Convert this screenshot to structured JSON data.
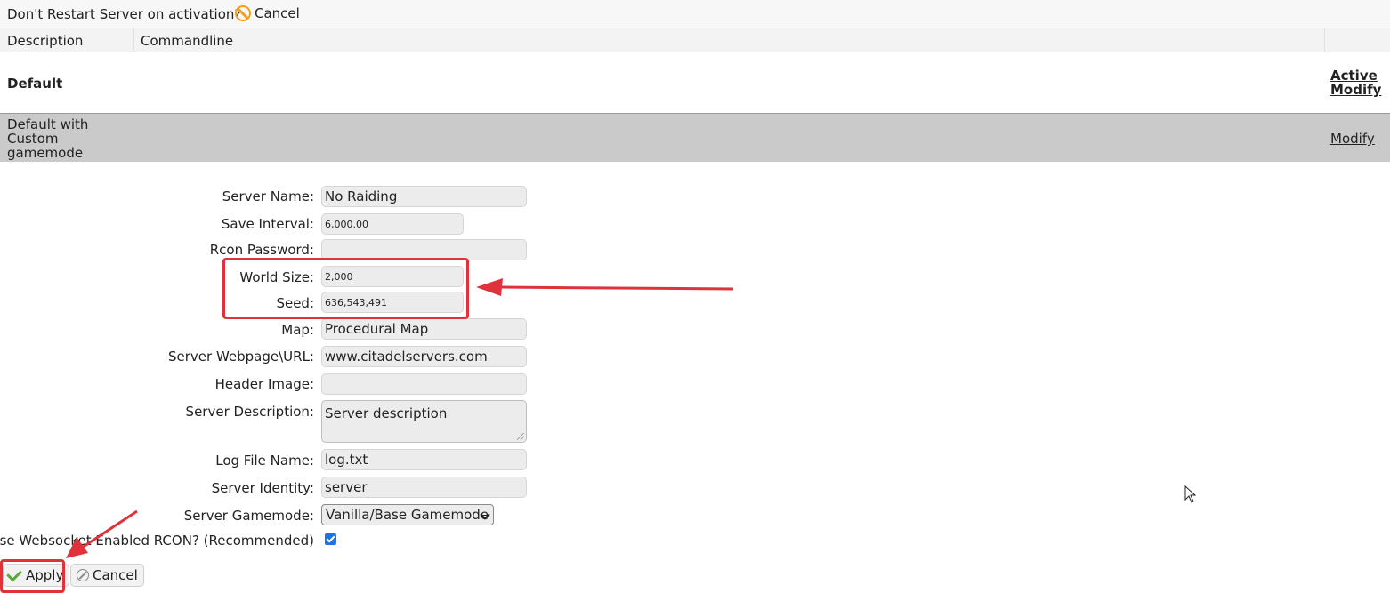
{
  "topbar": {
    "prompt": "Don't Restart Server on activation?",
    "cancel_label": "Cancel"
  },
  "table": {
    "headers": {
      "description": "Description",
      "commandline": "Commandline"
    },
    "rows": [
      {
        "name": "Default",
        "active_label": "Active",
        "modify_label": "Modify"
      },
      {
        "name": "Default with Custom gamemode",
        "modify_label": "Modify"
      }
    ]
  },
  "form": {
    "server_name": {
      "label": "Server Name:",
      "value": "No Raiding"
    },
    "save_interval": {
      "label": "Save Interval:",
      "value": "6,000.00"
    },
    "rcon_password": {
      "label": "Rcon Password:",
      "value": ""
    },
    "world_size": {
      "label": "World Size:",
      "value": "2,000"
    },
    "seed": {
      "label": "Seed:",
      "value": "636,543,491"
    },
    "map": {
      "label": "Map:",
      "value": "Procedural Map"
    },
    "webpage": {
      "label": "Server Webpage\\URL:",
      "value": "www.citadelservers.com"
    },
    "header_image": {
      "label": "Header Image:",
      "value": ""
    },
    "description": {
      "label": "Server Description:",
      "value": "Server description"
    },
    "log_file": {
      "label": "Log File Name:",
      "value": "log.txt"
    },
    "identity": {
      "label": "Server Identity:",
      "value": "server"
    },
    "gamemode": {
      "label": "Server Gamemode:",
      "value": "Vanilla/Base Gamemode"
    },
    "websocket": {
      "label": "Use Websocket Enabled RCON? (Recommended)",
      "checked": true
    }
  },
  "actions": {
    "apply_label": "Apply",
    "cancel_label": "Cancel"
  },
  "annotation_color": "#e0323a"
}
